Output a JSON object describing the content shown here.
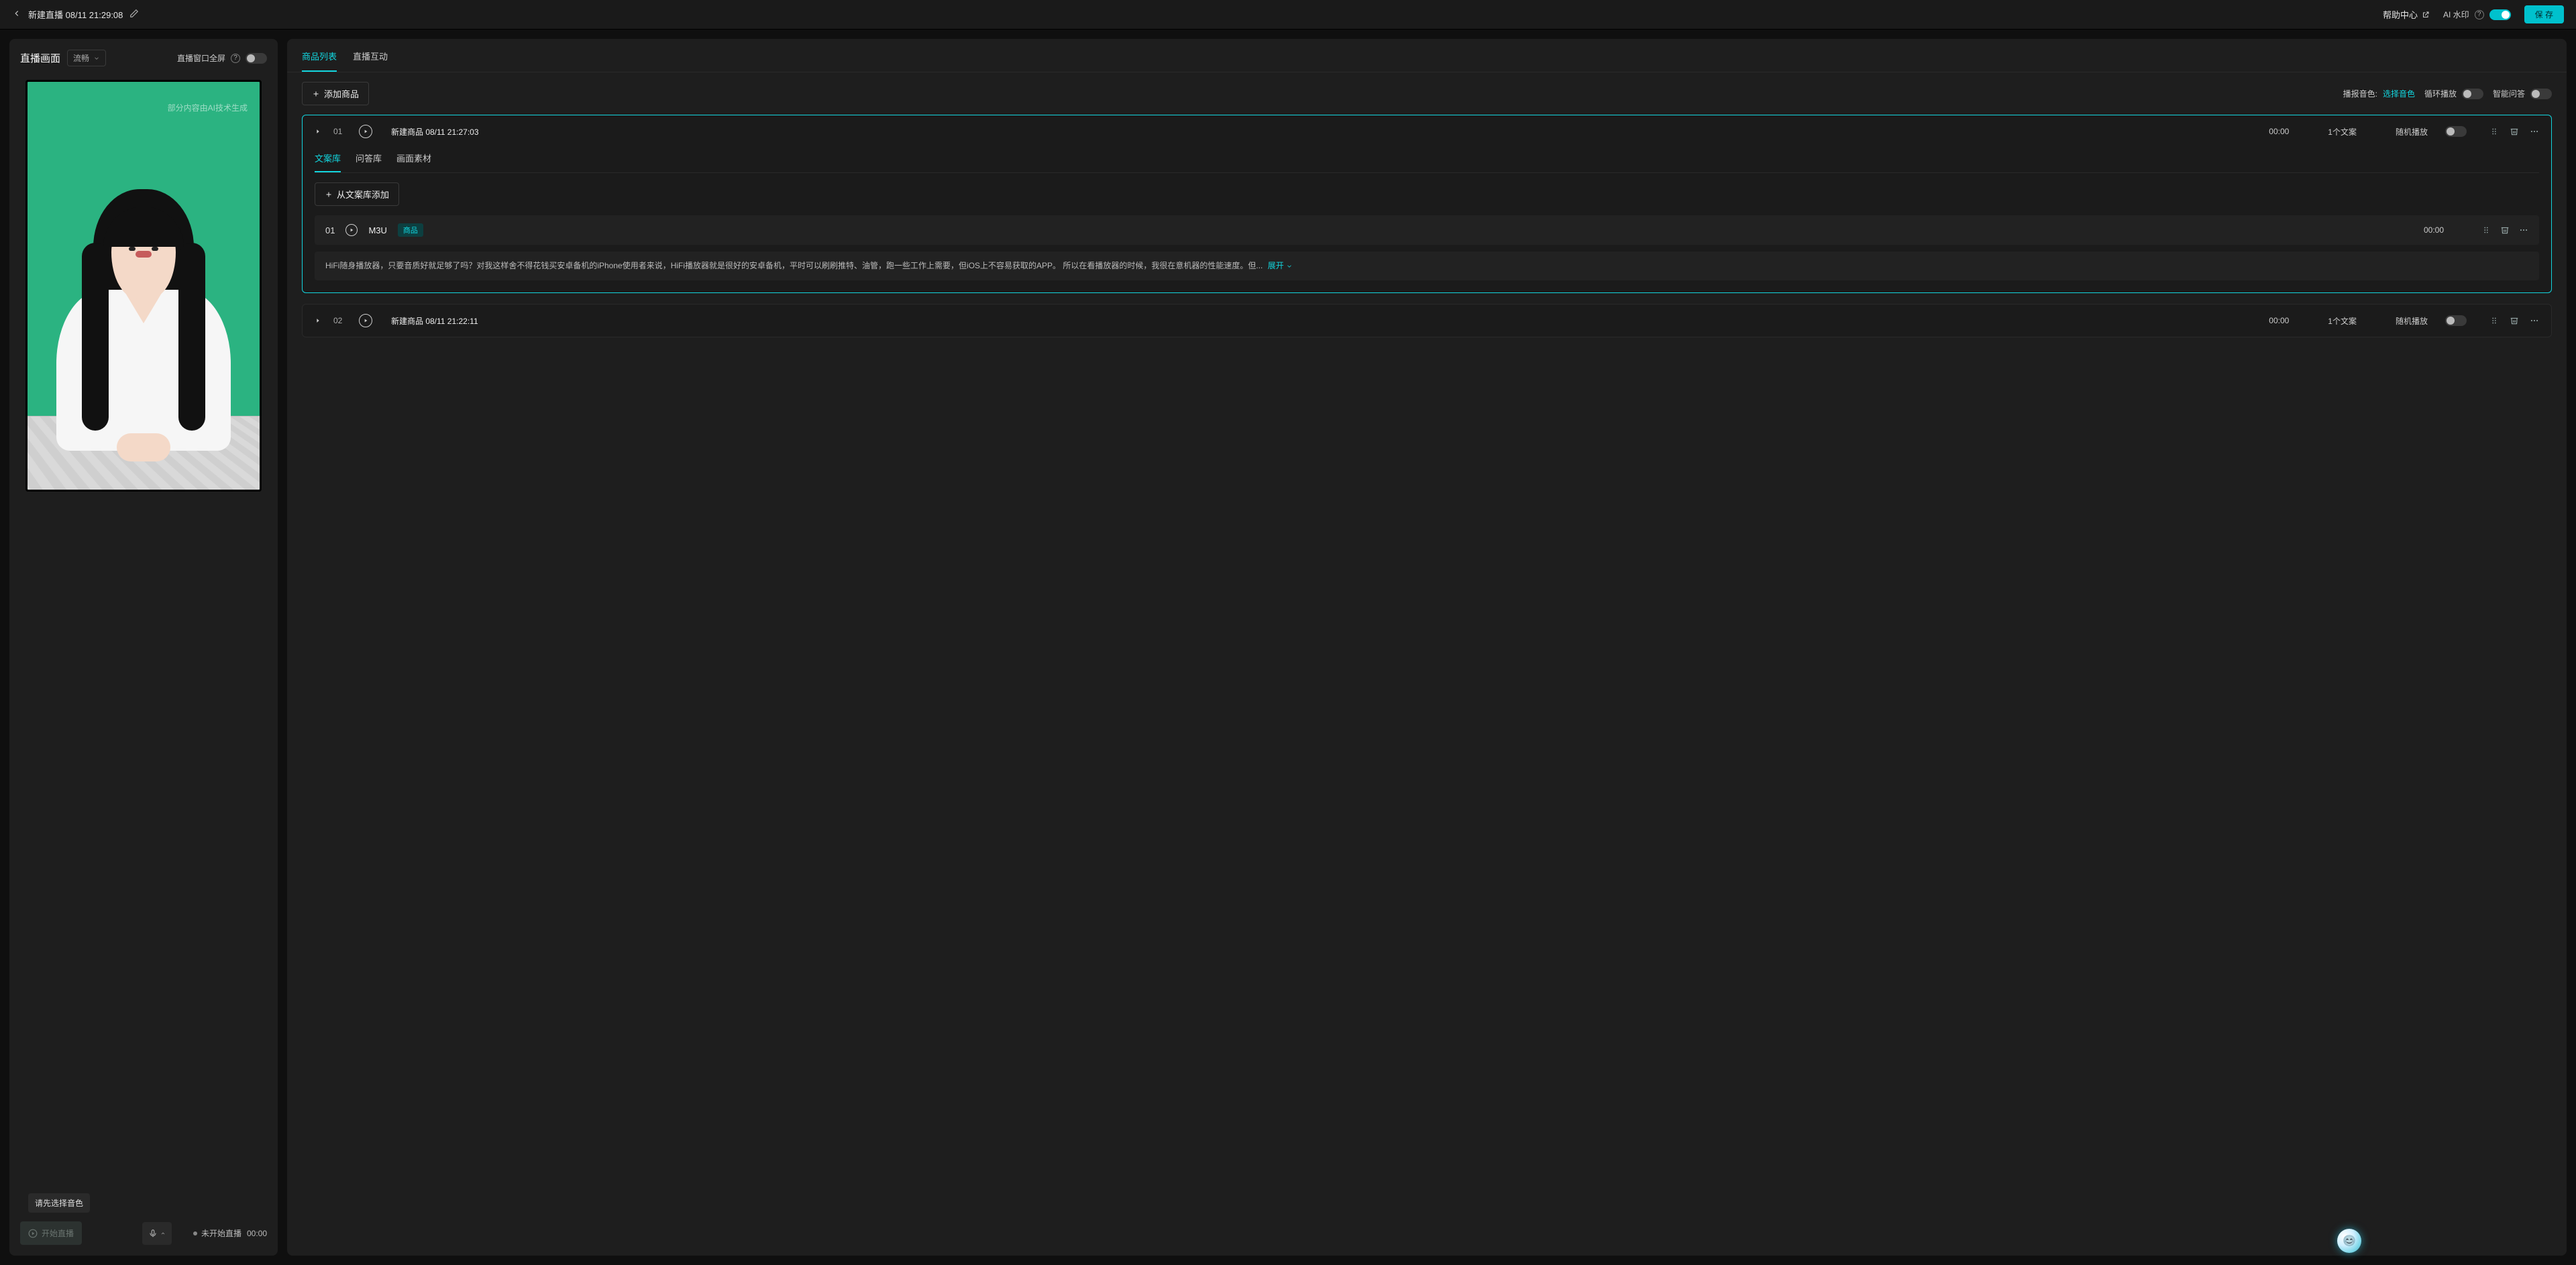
{
  "header": {
    "title": "新建直播 08/11 21:29:08",
    "help_label": "帮助中心",
    "watermark_label": "AI 水印",
    "watermark_on": true,
    "save_label": "保 存"
  },
  "left": {
    "title": "直播画面",
    "quality_label": "流畅",
    "fullscreen_label": "直播窗口全屏",
    "fullscreen_on": false,
    "canvas_watermark": "部分内容由AI技术生成",
    "tooltip": "请先选择音色",
    "start_label": "开始直播",
    "status_label": "未开始直播",
    "status_time": "00:00"
  },
  "right": {
    "tabs": [
      {
        "label": "商品列表",
        "active": true
      },
      {
        "label": "直播互动",
        "active": false
      }
    ],
    "add_product_label": "添加商品",
    "toolbar": {
      "voice_label": "播报音色:",
      "voice_value": "选择音色",
      "loop_label": "循环播放",
      "loop_on": false,
      "qa_label": "智能问答",
      "qa_on": false
    },
    "products": [
      {
        "index": "01",
        "title": "新建商品 08/11 21:27:03",
        "time": "00:00",
        "count": "1个文案",
        "random_label": "随机播放",
        "random_on": false,
        "expanded": true,
        "sub_tabs": [
          {
            "label": "文案库",
            "active": true
          },
          {
            "label": "问答库",
            "active": false
          },
          {
            "label": "画面素材",
            "active": false
          }
        ],
        "add_from_lib_label": "从文案库添加",
        "scripts": [
          {
            "index": "01",
            "title": "M3U",
            "tag": "商品",
            "time": "00:00",
            "text": "HiFi随身播放器，只要音质好就足够了吗？对我这样舍不得花钱买安卓备机的iPhone使用者来说，HiFi播放器就是很好的安卓备机，平时可以刷刷推特、油管，跑一些工作上需要，但iOS上不容易获取的APP。 所以在看播放器的时候，我很在意机器的性能速度。但...",
            "expand_label": "展开"
          }
        ]
      },
      {
        "index": "02",
        "title": "新建商品 08/11 21:22:11",
        "time": "00:00",
        "count": "1个文案",
        "random_label": "随机播放",
        "random_on": false,
        "expanded": false
      }
    ]
  }
}
